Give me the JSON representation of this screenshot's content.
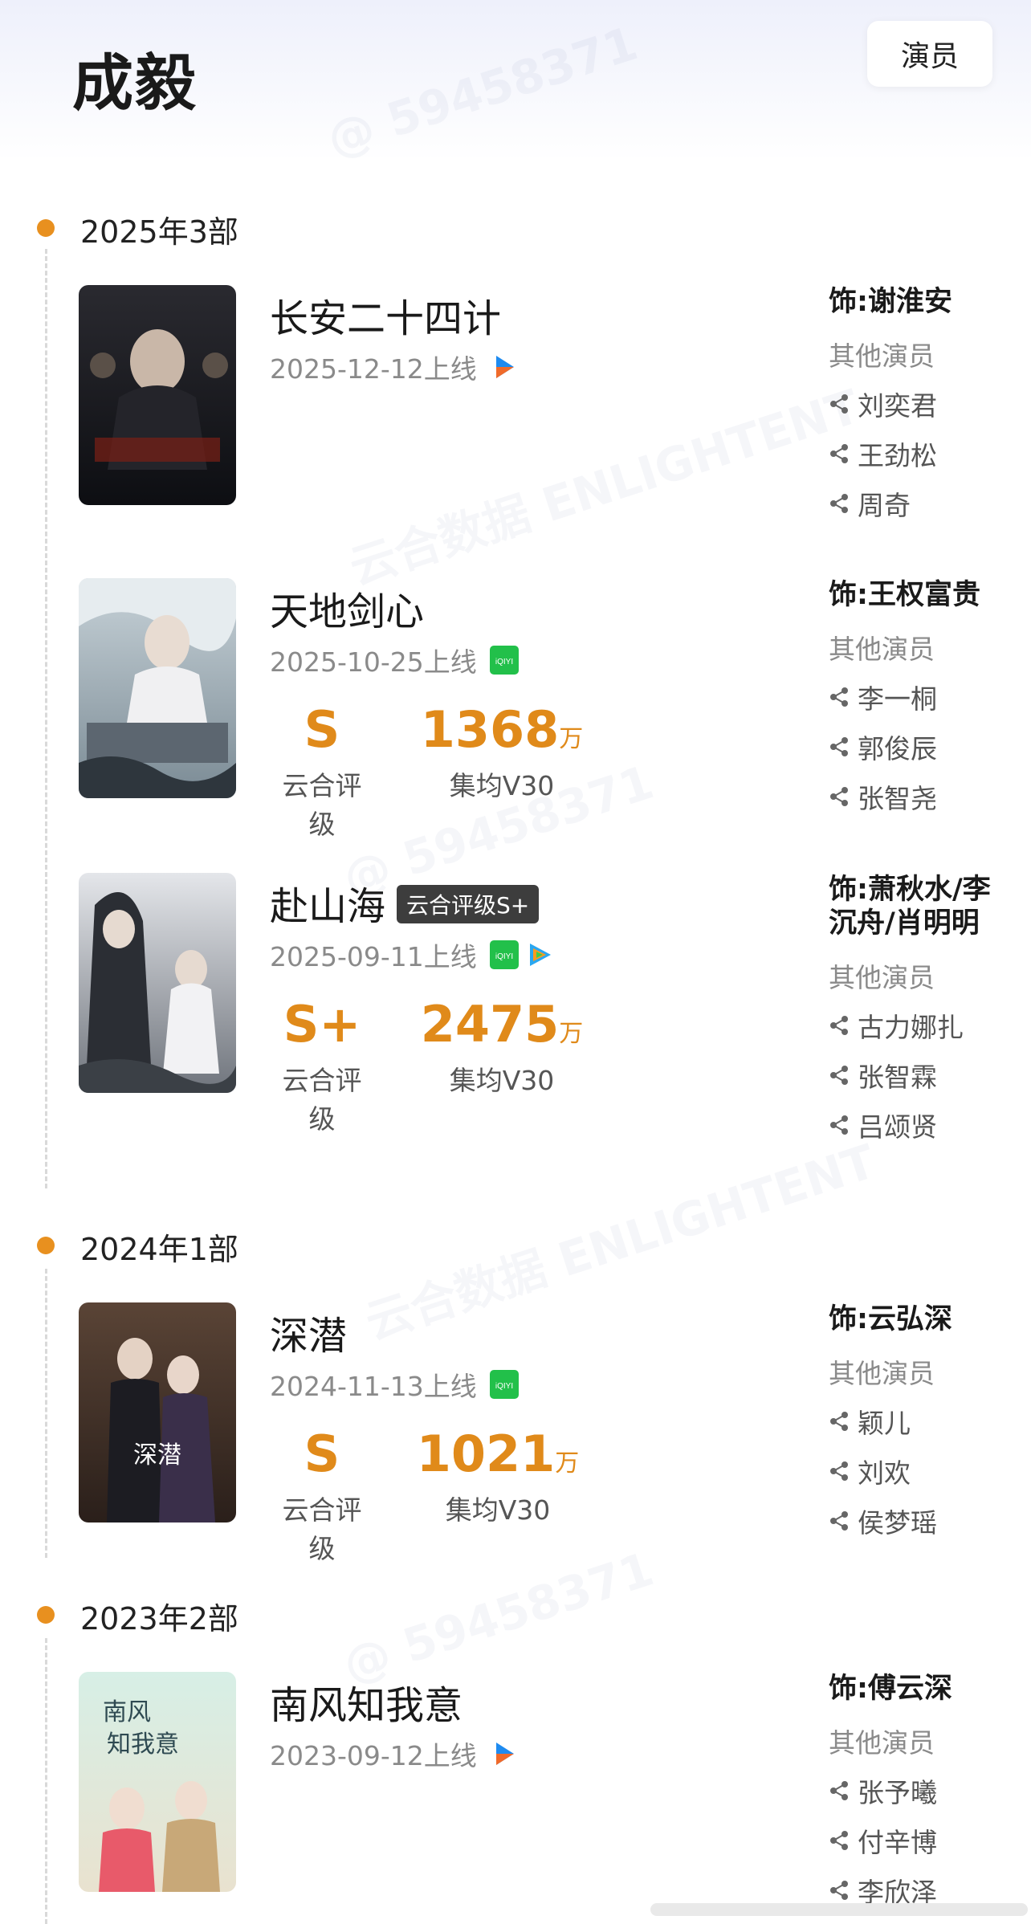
{
  "header": {
    "title": "成毅",
    "role_button": "演员"
  },
  "sections": [
    {
      "year_label": "2025年3部",
      "entries": [
        {
          "title": "长安二十四计",
          "badge": "",
          "release": "2025-12-12上线",
          "platforms": [
            "youku-icon"
          ],
          "rating": null,
          "views": null,
          "role": "饰:谢淮安",
          "other_cast_label": "其他演员",
          "cast": [
            "刘奕君",
            "王劲松",
            "周奇"
          ]
        },
        {
          "title": "天地剑心",
          "badge": "",
          "release": "2025-10-25上线",
          "platforms": [
            "iqiyi-icon"
          ],
          "rating": "S",
          "rating_label": "云合评级",
          "views": "1368",
          "views_unit": "万",
          "views_label": "集均V30",
          "role": "饰:王权富贵",
          "other_cast_label": "其他演员",
          "cast": [
            "李一桐",
            "郭俊辰",
            "张智尧"
          ]
        },
        {
          "title": "赴山海",
          "badge": "云合评级S+",
          "release": "2025-09-11上线",
          "platforms": [
            "iqiyi-icon",
            "tencent-video-icon"
          ],
          "rating": "S+",
          "rating_label": "云合评级",
          "views": "2475",
          "views_unit": "万",
          "views_label": "集均V30",
          "role": "饰:萧秋水/李沉舟/肖明明",
          "other_cast_label": "其他演员",
          "cast": [
            "古力娜扎",
            "张智霖",
            "吕颂贤"
          ]
        }
      ]
    },
    {
      "year_label": "2024年1部",
      "entries": [
        {
          "title": "深潜",
          "badge": "",
          "release": "2024-11-13上线",
          "platforms": [
            "iqiyi-icon"
          ],
          "rating": "S",
          "rating_label": "云合评级",
          "views": "1021",
          "views_unit": "万",
          "views_label": "集均V30",
          "role": "饰:云弘深",
          "other_cast_label": "其他演员",
          "cast": [
            "颖儿",
            "刘欢",
            "侯梦瑶"
          ]
        }
      ]
    },
    {
      "year_label": "2023年2部",
      "entries": [
        {
          "title": "南风知我意",
          "badge": "",
          "release": "2023-09-12上线",
          "platforms": [
            "youku-icon"
          ],
          "rating": null,
          "views": null,
          "role": "饰:傅云深",
          "other_cast_label": "其他演员",
          "cast": [
            "张予曦",
            "付辛博",
            "李欣泽"
          ]
        }
      ]
    }
  ],
  "watermarks": {
    "user_id": "@ 59458371",
    "brand_cn": "云合数据",
    "brand_en": "ENLIGHTENT"
  },
  "colors": {
    "accent": "#e08a1a",
    "dot": "#e8901f",
    "badge_bg": "#3d3d3d"
  }
}
